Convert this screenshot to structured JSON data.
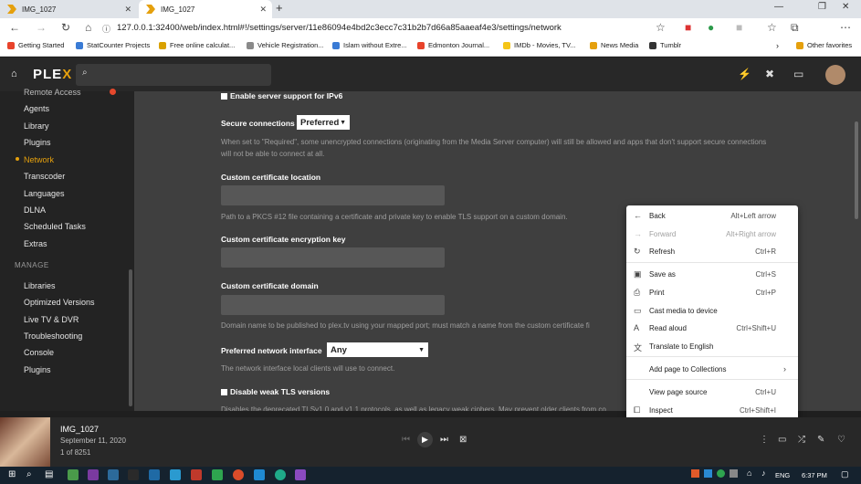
{
  "browser": {
    "tabs": [
      {
        "title": "IMG_1027"
      },
      {
        "title": "IMG_1027"
      }
    ],
    "url": "127.0.0.1:32400/web/index.html#!/settings/server/11e86094e4bd2c3ecc7c31b2b7d66a85aaeaf4e3/settings/network",
    "bookmarks": [
      "Getting Started",
      "StatCounter Projects",
      "Free online calculat...",
      "Vehicle Registration...",
      "Islam without Extre...",
      "Edmonton Journal...",
      "IMDb - Movies, TV...",
      "News Media",
      "Tumblr"
    ],
    "other_favorites": "Other favorites",
    "bookmark_colors": [
      "#e8432b",
      "#3a7bd5",
      "#d9a100",
      "#8a8a8a",
      "#3a7bd5",
      "#e8432b",
      "#f5c518",
      "#e5a00d",
      "#333333"
    ]
  },
  "plex": {
    "logo_pre": "PLE",
    "logo_x": "X",
    "accent": "#e5a00d"
  },
  "sidebar": {
    "items": [
      "Remote Access",
      "Agents",
      "Library",
      "Plugins",
      "Network",
      "Transcoder",
      "Languages",
      "DLNA",
      "Scheduled Tasks",
      "Extras"
    ],
    "manage_heading": "MANAGE",
    "manage_items": [
      "Libraries",
      "Optimized Versions",
      "Live TV & DVR",
      "Troubleshooting",
      "Console",
      "Plugins"
    ]
  },
  "settings": {
    "ipv6_label": "Enable server support for IPv6",
    "secure_label": "Secure connections",
    "secure_value": "Preferred",
    "secure_help": "When set to \"Required\", some unencrypted connections (originating from the Media Server computer) will still be allowed and apps that don't support secure connections will not be able to connect at all.",
    "cert_location_label": "Custom certificate location",
    "cert_location_help": "Path to a PKCS #12 file containing a certificate and private key to enable TLS support on a custom domain.",
    "cert_key_label": "Custom certificate encryption key",
    "cert_domain_label": "Custom certificate domain",
    "cert_domain_help": "Domain name to be published to plex.tv using your mapped port; must match a name from the custom certificate fi",
    "net_iface_label": "Preferred network interface",
    "net_iface_value": "Any",
    "net_iface_help": "The network interface local clients will use to connect.",
    "weak_tls_label": "Disable weak TLS versions",
    "weak_tls_help": "Disables the deprecated TLSv1.0 and v1.1 protocols, as well as legacy weak ciphers. May prevent older clients from co"
  },
  "context_menu": {
    "items": [
      {
        "label": "Back",
        "shortcut": "Alt+Left arrow",
        "icon": "back-arrow-icon",
        "disabled": false
      },
      {
        "label": "Forward",
        "shortcut": "Alt+Right arrow",
        "icon": "forward-arrow-icon",
        "disabled": true
      },
      {
        "label": "Refresh",
        "shortcut": "Ctrl+R",
        "icon": "refresh-icon",
        "disabled": false
      },
      {
        "label": "Save as",
        "shortcut": "Ctrl+S",
        "icon": "save-icon",
        "disabled": false
      },
      {
        "label": "Print",
        "shortcut": "Ctrl+P",
        "icon": "print-icon",
        "disabled": false
      },
      {
        "label": "Cast media to device",
        "shortcut": "",
        "icon": "cast-icon",
        "disabled": false
      },
      {
        "label": "Read aloud",
        "shortcut": "Ctrl+Shift+U",
        "icon": "read-aloud-icon",
        "disabled": false
      },
      {
        "label": "Translate to English",
        "shortcut": "",
        "icon": "translate-icon",
        "disabled": false
      },
      {
        "label": "Add page to Collections",
        "shortcut": "",
        "icon": "collections-icon",
        "disabled": false
      },
      {
        "label": "View page source",
        "shortcut": "Ctrl+U",
        "icon": "",
        "disabled": false
      },
      {
        "label": "Inspect",
        "shortcut": "Ctrl+Shift+I",
        "icon": "inspect-icon",
        "disabled": false
      }
    ]
  },
  "player": {
    "title": "IMG_1027",
    "date": "September 11, 2020",
    "position": "1 of 8251"
  },
  "taskbar": {
    "language": "ENG",
    "time": "6:37 PM"
  }
}
